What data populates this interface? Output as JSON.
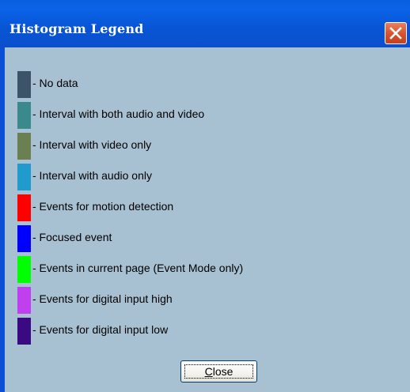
{
  "window": {
    "title": "Histogram Legend"
  },
  "legend": {
    "items": [
      {
        "label": "- No data",
        "color": "#3c5468"
      },
      {
        "label": "- Interval with both audio and video",
        "color": "#3a8a8c"
      },
      {
        "label": "- Interval with video only",
        "color": "#6a8050"
      },
      {
        "label": "- Interval with audio only",
        "color": "#1f9ccd"
      },
      {
        "label": "- Events for motion detection",
        "color": "#ff0000"
      },
      {
        "label": "- Focused event",
        "color": "#0000ff"
      },
      {
        "label": "- Events in current page (Event Mode only)",
        "color": "#00ff00"
      },
      {
        "label": "- Events for digital input high",
        "color": "#c040f0"
      },
      {
        "label": "- Events for digital input low",
        "color": "#3a0a82"
      }
    ]
  },
  "buttons": {
    "close_mnemonic": "C",
    "close_rest": "lose"
  },
  "colors": {
    "titlebar": "#0a5ee0",
    "client_background": "#a8c1d2",
    "close_button_accent": "#d6512f"
  },
  "icons": {
    "title_close": "close-icon"
  }
}
